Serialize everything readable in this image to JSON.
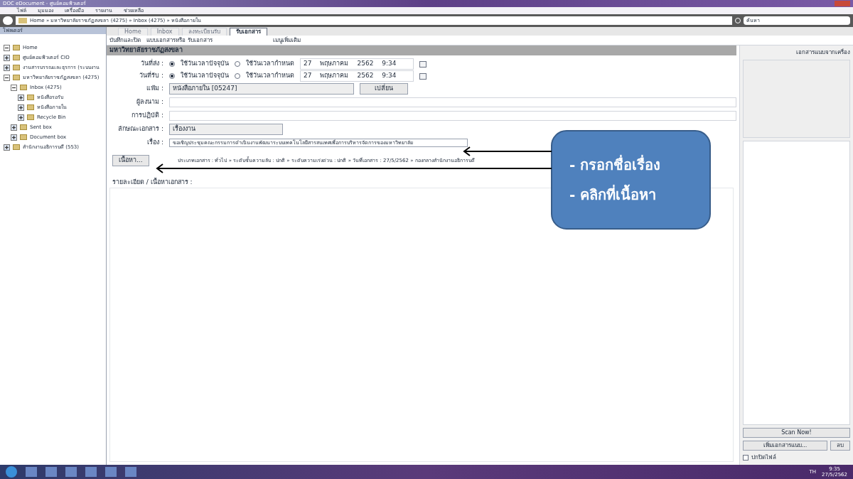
{
  "window": {
    "title": "DOC eDocument - ศูนย์คอมพิวเตอร์"
  },
  "menu": [
    "ไฟล์",
    "มุมมอง",
    "เครื่องมือ",
    "รายงาน",
    "ช่วยเหลือ"
  ],
  "address": {
    "path": "Home » มหาวิทยาลัยราชภัฏสงขลา (4275) » Inbox (4275) » หนังสือภายใน",
    "search": "ค้นหา"
  },
  "sidebar": {
    "title": "โฟลเดอร์",
    "tree": [
      {
        "label": "Home",
        "expanded": true
      },
      {
        "label": "ศูนย์คอมพิวเตอร์ CIO",
        "expanded": false
      },
      {
        "label": "งานสารบรรณและธุรการ (ระบบงาน",
        "expanded": false
      },
      {
        "label": "มหาวิทยาลัยราชภัฏสงขลา (4275)",
        "expanded": true,
        "children": [
          {
            "label": "Inbox (4275)",
            "expanded": true,
            "children": [
              {
                "label": "หนังสือรอรับ",
                "expanded": false
              },
              {
                "label": "หนังสือภายใน",
                "expanded": false
              },
              {
                "label": "Recycle Bin",
                "expanded": false
              }
            ]
          },
          {
            "label": "Sent box",
            "expanded": false
          },
          {
            "label": "Document box",
            "expanded": false
          }
        ]
      },
      {
        "label": "สำนักงานอธิการบดี (553)",
        "expanded": false
      }
    ]
  },
  "tabs": [
    {
      "label": "Home",
      "selected": false
    },
    {
      "label": "Inbox",
      "selected": false
    },
    {
      "label": "ลงทะเบียนรับ",
      "selected": false
    },
    {
      "label": "รับเอกสาร",
      "selected": true
    }
  ],
  "toolbar": {
    "save": "บันทึกและปิด",
    "template": "แบบเอกสารหรือ รับเอกสาร",
    "more": "เมนูเพิ่มเติม"
  },
  "form": {
    "heading": "มหาวิทยาลัยราชภัฏสงขลา",
    "dates": [
      {
        "label": "วันที่ส่ง :",
        "option_now": "ใช้วันเวลาปัจจุบัน",
        "option_custom": "ใช้วันเวลากำหนด",
        "now_selected": true,
        "day": "27",
        "month": "พฤษภาคม",
        "year": "2562",
        "time": "9:34"
      },
      {
        "label": "วันที่รับ :",
        "option_now": "ใช้วันเวลาปัจจุบัน",
        "option_custom": "ใช้วันเวลากำหนด",
        "now_selected": true,
        "day": "27",
        "month": "พฤษภาคม",
        "year": "2562",
        "time": "9:34"
      }
    ],
    "folder": {
      "label": "แฟ้ม :",
      "value": "หนังสือภายใน [05247]",
      "button": "เปลี่ยน"
    },
    "signer": {
      "label": "ผู้ลงนาม :"
    },
    "action": {
      "label": "การปฏิบัติ :"
    },
    "doctype": {
      "label": "ลักษณะเอกสาร :",
      "value": "เรื่องงาน"
    },
    "subject": {
      "label": "เรื่อง :",
      "value": "ขอเชิญประชุมคณะกรรมการดำเนินงานพัฒนาระบบเทคโนโลยีสารสนเทศเพื่อการบริหารจัดการของมหาวิทยาลัย"
    },
    "content_button": "เนื้อหา...",
    "summary": "ประเภทเอกสาร : ทั่วไป » ระดับชั้นความลับ : ปกติ » ระดับความเร่งด่วน : ปกติ » วันที่เอกสาร : 27/5/2562 » กองกลางสำนักงานอธิการบดี",
    "detail_label": "รายละเอียด / เนื้อหาเอกสาร :"
  },
  "attachments": {
    "title": "เอกสารแนบจากเครื่อง",
    "scan": "Scan Now!",
    "add": "เพิ่มเอกสารแนบ...",
    "delete": "ลบ",
    "hide_label": "ปกปิดไฟล์",
    "hide_checked": false
  },
  "callout": [
    "- กรอกชื่อเรื่อง",
    "- คลิกที่เนื้อหา"
  ],
  "taskbar": {
    "lang": "TH",
    "time": "9:35",
    "date": "27/5/2562"
  }
}
